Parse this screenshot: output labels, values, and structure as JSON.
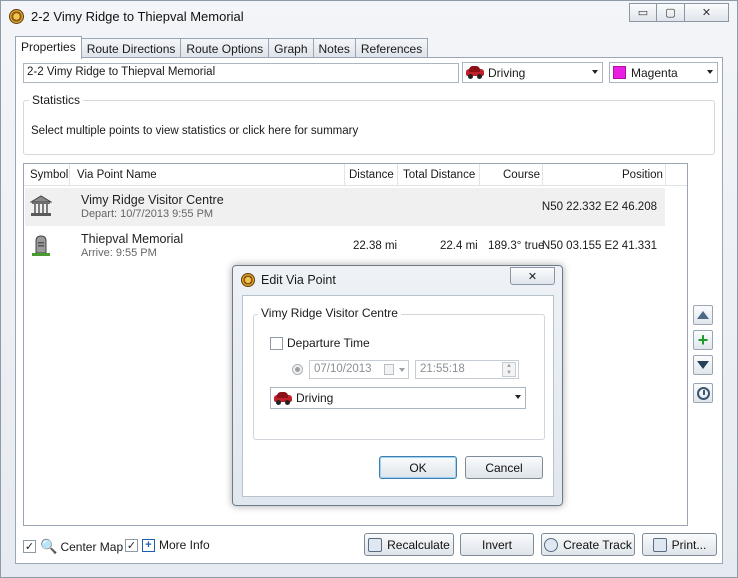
{
  "window": {
    "title": "2-2 Vimy Ridge to Thiepval Memorial",
    "minimize_glyph": "▭",
    "maximize_glyph": "▢",
    "close_glyph": "✕"
  },
  "tabs": [
    {
      "label": "Properties",
      "active": true
    },
    {
      "label": "Route Directions"
    },
    {
      "label": "Route Options"
    },
    {
      "label": "Graph"
    },
    {
      "label": "Notes"
    },
    {
      "label": "References"
    }
  ],
  "properties": {
    "route_name": "2-2 Vimy Ridge to Thiepval Memorial",
    "mode": "Driving",
    "color_name": "Magenta",
    "color_hex": "#e81ee0"
  },
  "statistics": {
    "legend": "Statistics",
    "text": "Select multiple points to view statistics or click here for summary"
  },
  "table": {
    "headers": {
      "symbol": "Symbol",
      "via_point_name": "Via Point Name",
      "distance": "Distance",
      "total_distance": "Total Distance",
      "course": "Course",
      "position": "Position"
    },
    "rows": [
      {
        "symbol_icon": "museum-icon",
        "name": "Vimy Ridge Visitor Centre",
        "sub": "Depart: 10/7/2013 9:55 PM",
        "distance": "",
        "total_distance": "",
        "course": "",
        "position": "N50 22.332 E2 46.208"
      },
      {
        "symbol_icon": "cemetery-icon",
        "name": "Thiepval Memorial",
        "sub": "Arrive: 9:55 PM",
        "distance": "22.38 mi",
        "total_distance": "22.4 mi",
        "course": "189.3° true",
        "position": "N50 03.155 E2 41.331"
      }
    ]
  },
  "bottom": {
    "center_map": "Center Map",
    "more_info": "More Info",
    "recalculate": "Recalculate",
    "invert": "Invert",
    "create_track": "Create Track",
    "print": "Print..."
  },
  "dialog": {
    "title": "Edit Via Point",
    "group_title": "Vimy Ridge Visitor Centre",
    "departure_time_label": "Departure Time",
    "date": "07/10/2013",
    "time": "21:55:18",
    "mode": "Driving",
    "ok": "OK",
    "cancel": "Cancel"
  }
}
